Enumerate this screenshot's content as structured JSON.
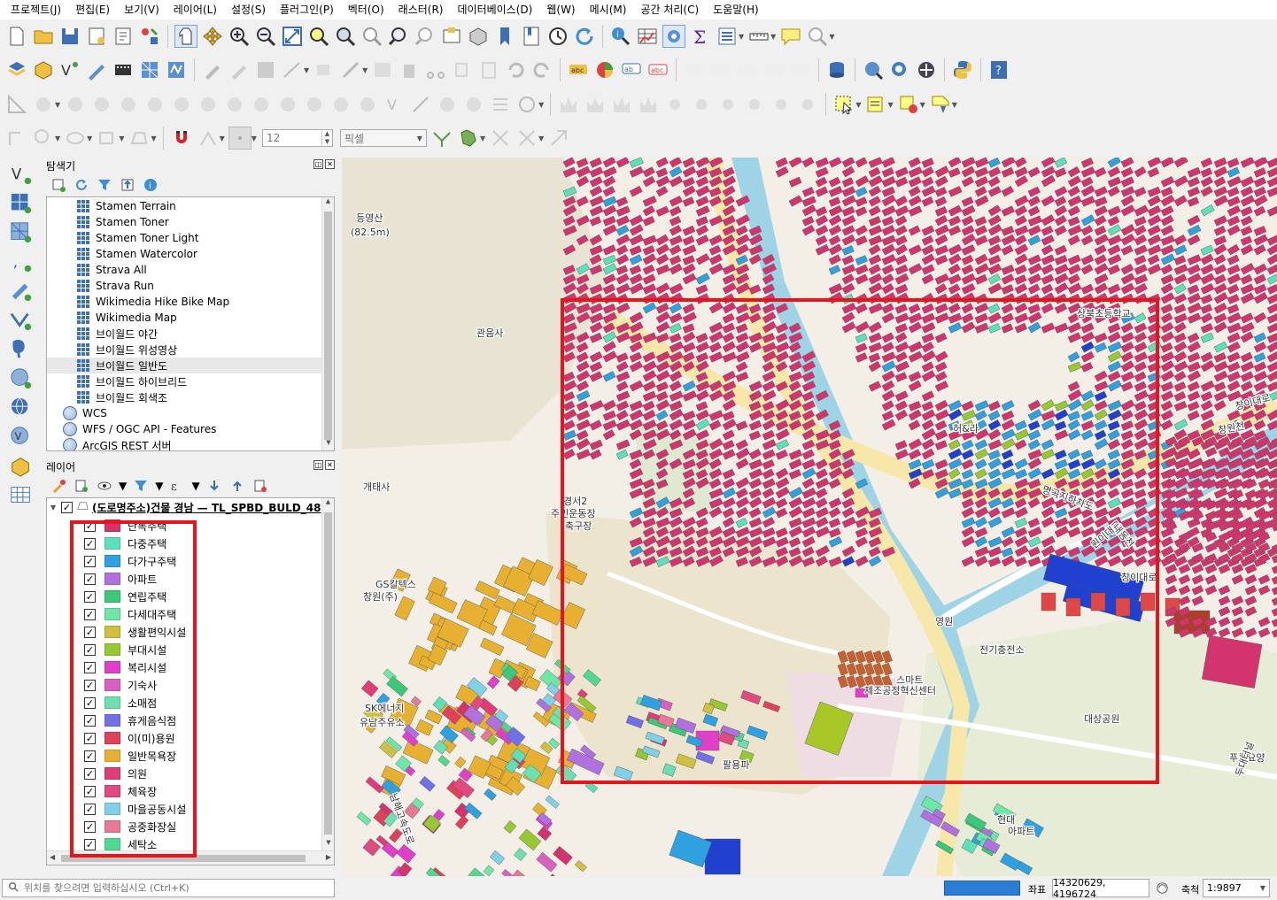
{
  "menu": [
    "프로젝트(J)",
    "편집(E)",
    "보기(V)",
    "레이어(L)",
    "설정(S)",
    "플러그인(P)",
    "벡터(O)",
    "래스터(R)",
    "데이터베이스(D)",
    "웹(W)",
    "메시(M)",
    "공간 처리(C)",
    "도움말(H)"
  ],
  "toolbar4": {
    "snap_tolerance": "12",
    "snap_unit": "픽셀"
  },
  "browser": {
    "title": "탐색기",
    "items": [
      {
        "label": "Stamen Terrain",
        "icon": "xyz-tile-icon"
      },
      {
        "label": "Stamen Toner",
        "icon": "xyz-tile-icon"
      },
      {
        "label": "Stamen Toner Light",
        "icon": "xyz-tile-icon"
      },
      {
        "label": "Stamen Watercolor",
        "icon": "xyz-tile-icon"
      },
      {
        "label": "Strava All",
        "icon": "xyz-tile-icon"
      },
      {
        "label": "Strava Run",
        "icon": "xyz-tile-icon"
      },
      {
        "label": "Wikimedia Hike Bike Map",
        "icon": "xyz-tile-icon"
      },
      {
        "label": "Wikimedia Map",
        "icon": "xyz-tile-icon"
      },
      {
        "label": "브이월드 야간",
        "icon": "xyz-tile-icon"
      },
      {
        "label": "브이월드 위성영상",
        "icon": "xyz-tile-icon"
      },
      {
        "label": "브이월드 일반도",
        "icon": "xyz-tile-icon"
      },
      {
        "label": "브이월드 하이브리드",
        "icon": "xyz-tile-icon"
      },
      {
        "label": "브이월드 회색조",
        "icon": "xyz-tile-icon"
      },
      {
        "label": "WCS",
        "icon": "globe-icon"
      },
      {
        "label": "WFS / OGC API - Features",
        "icon": "globe-icon"
      },
      {
        "label": "ArcGIS REST 서버",
        "icon": "globe-icon"
      }
    ]
  },
  "layers": {
    "title": "레이어",
    "layer_name": "(도로명주소)건물 경남 — TL_SPBD_BULD_48",
    "categories": [
      {
        "label": "단독주택",
        "color": "#d4346e"
      },
      {
        "label": "다중주택",
        "color": "#5ce0b8"
      },
      {
        "label": "다가구주택",
        "color": "#2fa0e0"
      },
      {
        "label": "아파트",
        "color": "#b070e0"
      },
      {
        "label": "연립주택",
        "color": "#3cc878"
      },
      {
        "label": "다세대주택",
        "color": "#6ee6a6"
      },
      {
        "label": "생활편익시설",
        "color": "#cfc040"
      },
      {
        "label": "부대시설",
        "color": "#96c832"
      },
      {
        "label": "복리시설",
        "color": "#e040c8"
      },
      {
        "label": "기숙사",
        "color": "#d860c0"
      },
      {
        "label": "소매점",
        "color": "#6ee0b0"
      },
      {
        "label": "휴게음식점",
        "color": "#7070e8"
      },
      {
        "label": "이(미)용원",
        "color": "#e0405a"
      },
      {
        "label": "일반목욕장",
        "color": "#e8b030"
      },
      {
        "label": "의원",
        "color": "#e03c78"
      },
      {
        "label": "체육장",
        "color": "#e04a80"
      },
      {
        "label": "마을공동시설",
        "color": "#80d0e8"
      },
      {
        "label": "공중화장실",
        "color": "#e87898"
      },
      {
        "label": "세탁소",
        "color": "#50d890"
      }
    ]
  },
  "map": {
    "labels": [
      "등영산",
      "(82.5m)",
      "관음사",
      "경서2",
      "주민운동장",
      "축구장",
      "개태사",
      "GS칼텍스",
      "창원(주)",
      "SK에너지",
      "유남주유소",
      "상북초등학교",
      "허&라",
      "명곡지하차도",
      "원이대로",
      "창이대로",
      "창원천",
      "내동천",
      "전기충전소",
      "대상공원",
      "푸른요양",
      "스마트",
      "제조공정혁신센터",
      "팔용파",
      "현대",
      "아파트",
      "영원",
      "두대터널",
      "남해고속도로",
      "창이대로"
    ],
    "highlight_color": "#ff0000"
  },
  "status": {
    "locator_placeholder": "위치를 찾으려면 입력하십시오 (Ctrl+K)",
    "coord_label": "좌표",
    "coord_value": "14320629, 4196724",
    "scale_label": "축척",
    "scale_value": "1:9897"
  }
}
